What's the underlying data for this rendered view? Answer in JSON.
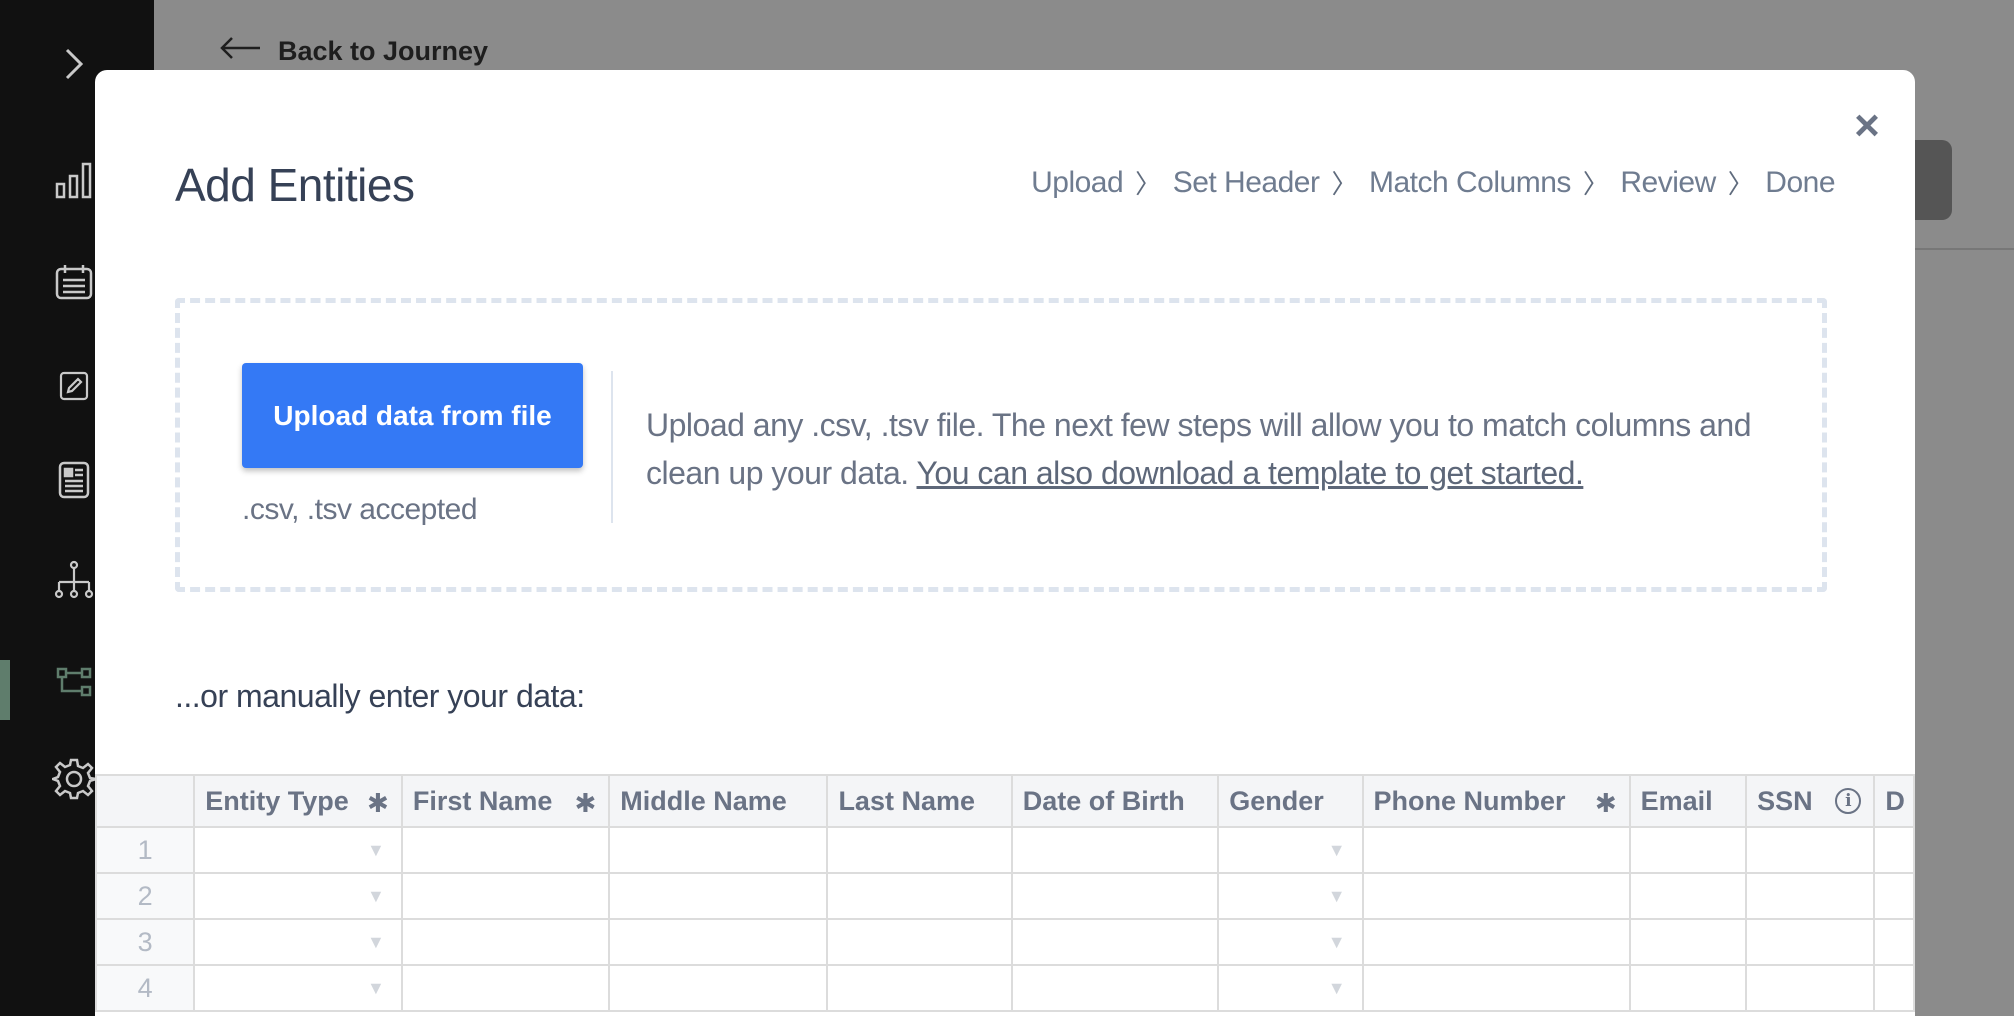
{
  "background_page": {
    "back_label": "Back to Journey"
  },
  "sidebar": {
    "items": [
      {
        "icon": "chevron-right-icon"
      },
      {
        "icon": "bar-chart-icon"
      },
      {
        "icon": "calendar-list-icon"
      },
      {
        "icon": "edit-icon"
      },
      {
        "icon": "document-icon"
      },
      {
        "icon": "org-chart-icon"
      },
      {
        "icon": "workflow-icon"
      },
      {
        "icon": "gear-icon"
      }
    ],
    "active_color": "#5f7d6c"
  },
  "modal": {
    "title": "Add Entities",
    "close_glyph": "×",
    "steps": [
      "Upload",
      "Set Header",
      "Match Columns",
      "Review",
      "Done"
    ],
    "step_separator": "〉",
    "upload_button": "Upload data from file",
    "accepted_formats": ".csv, .tsv accepted",
    "description": "Upload any .csv, .tsv file. The next few steps will allow you to match columns and clean up your data.",
    "template_link": "You can also download a template to get started.",
    "manual_label": "...or manually enter your data:"
  },
  "grid": {
    "columns": [
      {
        "label": "Entity Type",
        "required": true,
        "dropdown": true
      },
      {
        "label": "First Name",
        "required": true,
        "dropdown": false
      },
      {
        "label": "Middle Name",
        "required": false,
        "dropdown": false
      },
      {
        "label": "Last Name",
        "required": false,
        "dropdown": false
      },
      {
        "label": "Date of Birth",
        "required": false,
        "dropdown": false
      },
      {
        "label": "Gender",
        "required": false,
        "dropdown": true
      },
      {
        "label": "Phone Number",
        "required": true,
        "dropdown": false
      },
      {
        "label": "Email",
        "required": false,
        "dropdown": false
      },
      {
        "label": "SSN",
        "required": false,
        "dropdown": false,
        "info": true
      },
      {
        "label": "D",
        "required": false,
        "dropdown": false
      }
    ],
    "rows": [
      "1",
      "2",
      "3",
      "4"
    ],
    "required_glyph": "✱",
    "info_glyph": "i",
    "dropdown_glyph": "▼"
  },
  "colors": {
    "primary_button": "#3479f5",
    "title_text": "#364156",
    "muted_text": "#6a7385"
  }
}
